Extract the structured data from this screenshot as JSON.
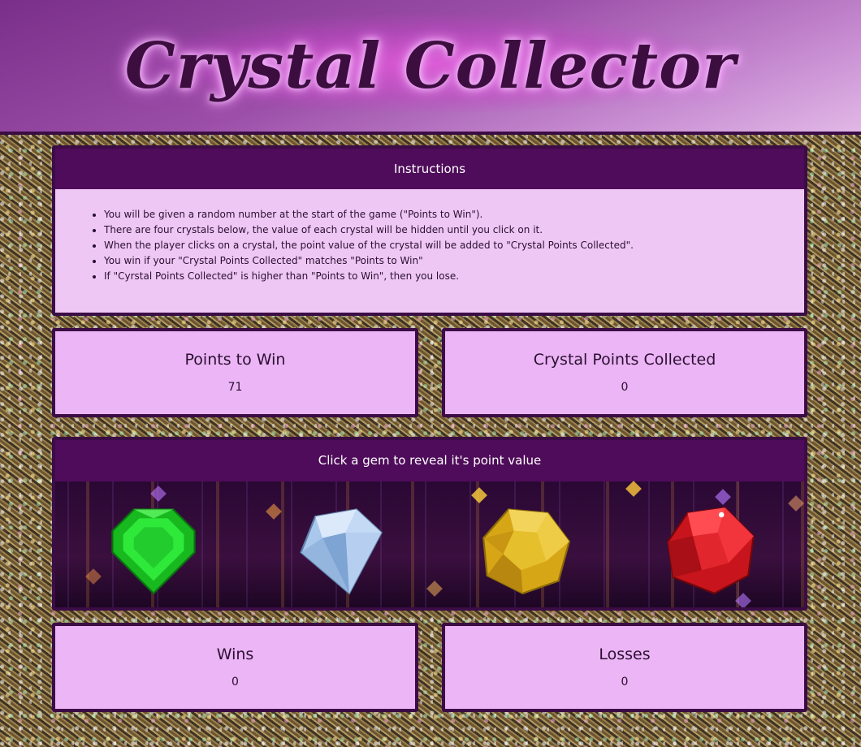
{
  "header": {
    "title": "Crystal Collector"
  },
  "instructions": {
    "heading": "Instructions",
    "items": [
      "You will be given a random number at the start of the game (\"Points to Win\").",
      "There are four crystals below, the value of each crystal will be hidden until you click on it.",
      "When the player clicks on a crystal, the point value of the crystal will be added to \"Crystal Points Collected\".",
      "You win if your \"Crystal Points Collected\" matches \"Points to Win\"",
      "If \"Cyrstal Points Collected\" is higher than \"Points to Win\", then you lose."
    ]
  },
  "points_to_win": {
    "label": "Points to Win",
    "value": "71"
  },
  "crystal_points": {
    "label": "Crystal Points Collected",
    "value": "0"
  },
  "gems_panel": {
    "heading": "Click a gem to reveal it's point value",
    "gems": [
      {
        "name": "green-emerald-gem",
        "color": "#1fcf2a"
      },
      {
        "name": "blue-diamond-gem",
        "color": "#a9c8ec"
      },
      {
        "name": "yellow-topaz-gem",
        "color": "#e3b91f"
      },
      {
        "name": "red-ruby-gem",
        "color": "#d41e25"
      }
    ]
  },
  "wins": {
    "label": "Wins",
    "value": "0"
  },
  "losses": {
    "label": "Losses",
    "value": "0"
  }
}
